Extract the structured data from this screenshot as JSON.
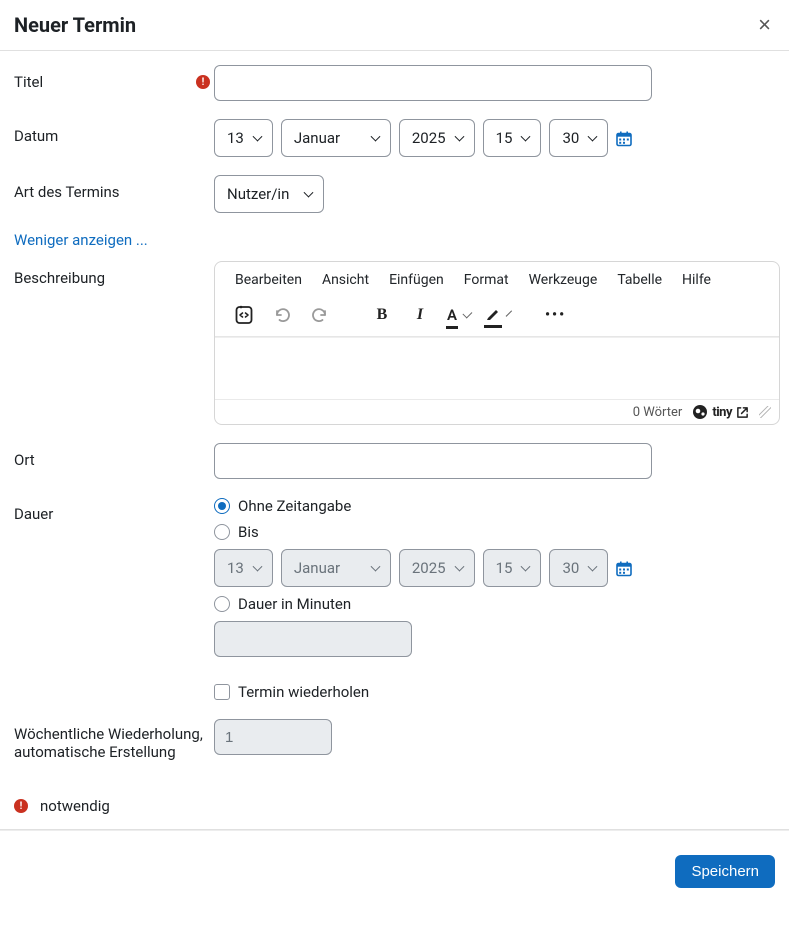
{
  "header": {
    "title": "Neuer Termin"
  },
  "labels": {
    "title": "Titel",
    "date": "Datum",
    "type": "Art des Termins",
    "showless": "Weniger anzeigen ...",
    "description": "Beschreibung",
    "location": "Ort",
    "duration": "Dauer",
    "repeat_weekly": "Wöchentliche Wiederholung, automatische Erstellung",
    "required_note": "notwendig"
  },
  "title_field": {
    "value": ""
  },
  "date": {
    "day": "13",
    "month": "Januar",
    "year": "2025",
    "hour": "15",
    "minute": "30"
  },
  "type_select": {
    "value": "Nutzer/in"
  },
  "editor": {
    "menus": [
      "Bearbeiten",
      "Ansicht",
      "Einfügen",
      "Format",
      "Werkzeuge",
      "Tabelle",
      "Hilfe"
    ],
    "wordcount": "0 Wörter",
    "brand": "tiny"
  },
  "location_field": {
    "value": ""
  },
  "duration": {
    "options": {
      "none": "Ohne Zeitangabe",
      "until": "Bis",
      "minutes": "Dauer in Minuten"
    },
    "selected": "none",
    "until": {
      "day": "13",
      "month": "Januar",
      "year": "2025",
      "hour": "15",
      "minute": "30"
    },
    "minutes_value": ""
  },
  "repeat": {
    "label": "Termin wiederholen",
    "checked": false
  },
  "weekly_value": "1",
  "footer": {
    "save": "Speichern"
  }
}
